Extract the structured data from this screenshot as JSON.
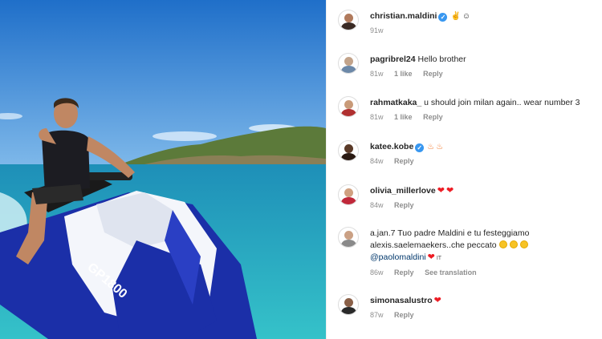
{
  "post": {
    "caption": {
      "username": "christian.maldini",
      "verified": true,
      "emojis": [
        "hand-icon",
        "smile-icon"
      ],
      "time": "91w"
    }
  },
  "comments": [
    {
      "username": "pagribrel24",
      "text": "Hello brother",
      "time": "81w",
      "likes": "1 like",
      "reply": "Reply"
    },
    {
      "username": "rahmatkaka_",
      "text": "u should join milan again.. wear number 3",
      "time": "81w",
      "likes": "1 like",
      "reply": "Reply"
    },
    {
      "username": "katee.kobe",
      "verified": true,
      "emojis": [
        "fire-icon",
        "fire-icon"
      ],
      "time": "84w",
      "reply": "Reply"
    },
    {
      "username": "olivia_millerlove",
      "emojis": [
        "heart-icon",
        "heart-icon"
      ],
      "time": "84w",
      "reply": "Reply"
    },
    {
      "username": "a.jan.7",
      "text": "Tuo padre Maldini e tu festeggiamo alexis.saelemaekers..che peccato",
      "mention": "@paolomaldini",
      "flag": "IT",
      "time": "86w",
      "reply": "Reply",
      "translate": "See translation"
    },
    {
      "username": "simonasalustro",
      "emojis": [
        "heart-icon"
      ],
      "time": "87w",
      "reply": "Reply"
    }
  ],
  "photo": {
    "jetski_label": "GP1800"
  },
  "colors": {
    "sky": "#3f8fd8",
    "sea": "#2fb3c6",
    "link": "#00376b",
    "verified": "#3897f0"
  }
}
